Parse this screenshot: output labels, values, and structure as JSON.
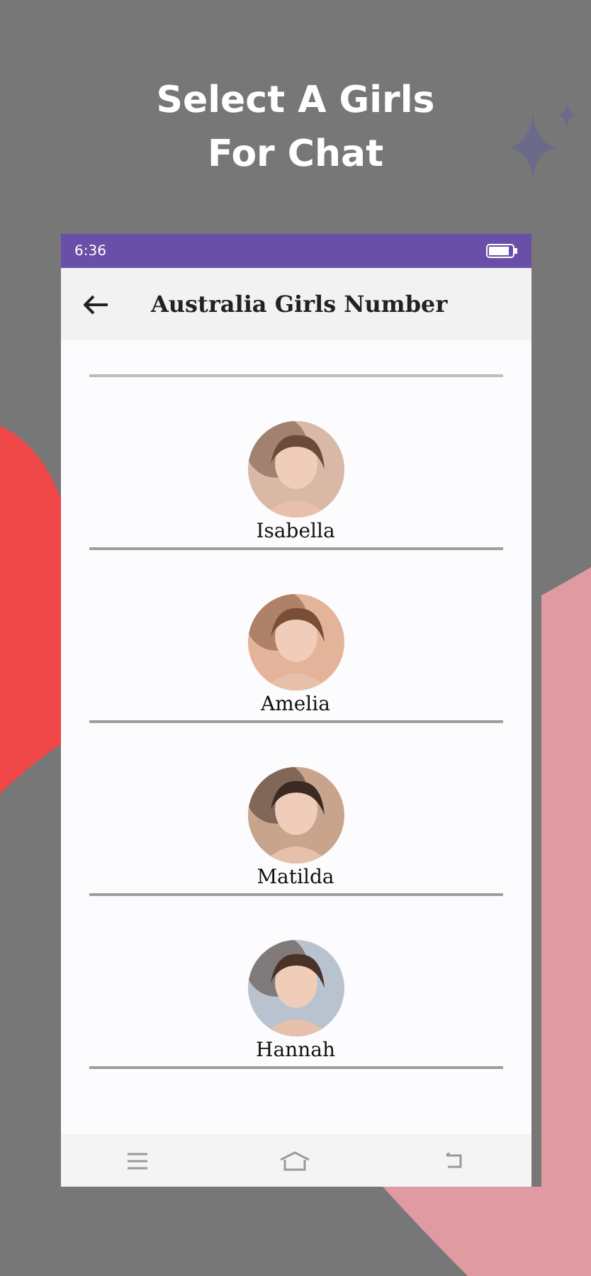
{
  "headline": "Select A Girls\nFor Chat",
  "status_bar": {
    "time": "6:36"
  },
  "app_bar": {
    "title": "Australia Girls Number"
  },
  "contacts": [
    {
      "name": "Isabella"
    },
    {
      "name": "Amelia"
    },
    {
      "name": "Matilda"
    },
    {
      "name": "Hannah"
    }
  ]
}
